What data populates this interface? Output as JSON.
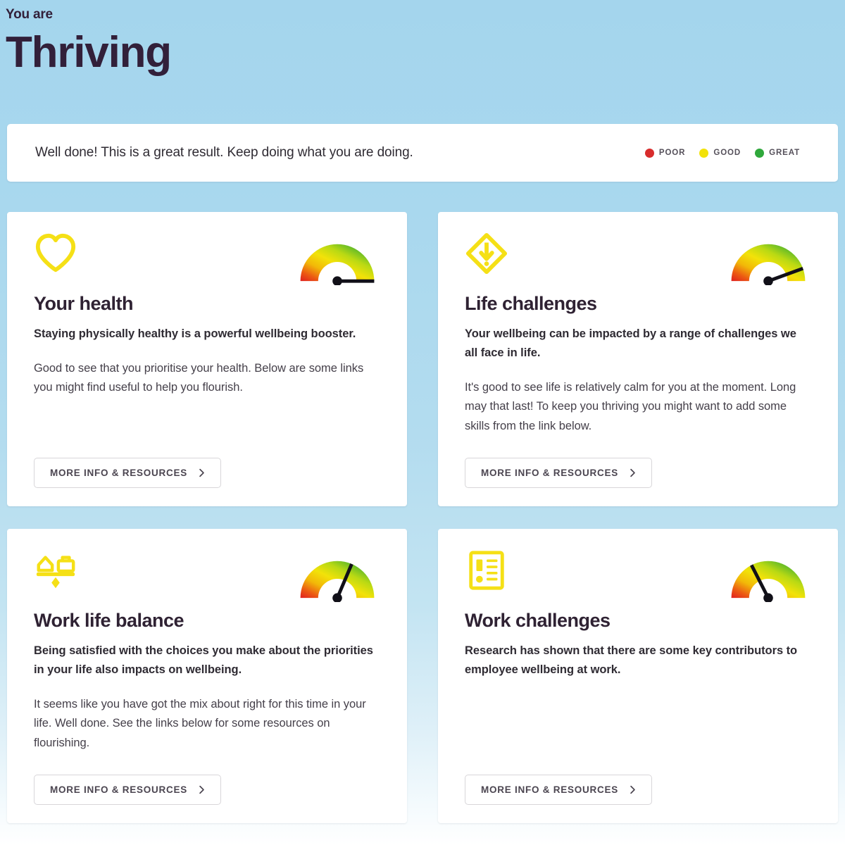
{
  "header": {
    "eyebrow": "You are",
    "title": "Thriving"
  },
  "banner": {
    "message": "Well done! This is a great result. Keep doing what you are doing.",
    "legend": [
      {
        "label": "POOR",
        "color": "#d82c2c",
        "icon": "legend-dot-poor"
      },
      {
        "label": "GOOD",
        "color": "#f2e209",
        "icon": "legend-dot-good"
      },
      {
        "label": "GREAT",
        "color": "#2fa83b",
        "icon": "legend-dot-great"
      }
    ]
  },
  "cards": [
    {
      "icon": "heart-icon",
      "title": "Your health",
      "lead": "Staying physically healthy is a powerful wellbeing booster.",
      "body": "Good to see that you prioritise your health. Below are some links you might find useful to help you flourish.",
      "cta": "MORE INFO & RESOURCES",
      "gauge_angle_deg": 0,
      "gauge_rating": "GREAT"
    },
    {
      "icon": "warning-diamond-icon",
      "title": "Life challenges",
      "lead": "Your wellbeing can be impacted by a range of challenges we all face in life.",
      "body": "It's good to see life is relatively calm for you at the moment. Long may that last! To keep you thriving you might want to add some skills from the link below.",
      "cta": "MORE INFO & RESOURCES",
      "gauge_angle_deg": 20,
      "gauge_rating": "GREAT"
    },
    {
      "icon": "work-life-balance-icon",
      "title": "Work life balance",
      "lead": "Being satisfied with the choices you make about the priorities in your life also impacts on wellbeing.",
      "body": "It seems like you have got the mix about right for this time in your life. Well done. See the links below for some resources on flourishing.",
      "cta": "MORE INFO & RESOURCES",
      "gauge_angle_deg": 67,
      "gauge_rating": "GOOD"
    },
    {
      "icon": "document-list-icon",
      "title": "Work challenges",
      "lead": "Research has shown that there are some key contributors to employee wellbeing at work.",
      "body": "",
      "cta": "MORE INFO & RESOURCES",
      "gauge_angle_deg": 117,
      "gauge_rating": "GOOD"
    }
  ],
  "theme": {
    "background_top": "#a4d5ed",
    "background_bottom": "#ffffff",
    "icon_yellow": "#f5e016",
    "text_dark": "#32203a",
    "gauge_red": "#e02020",
    "gauge_yellow": "#f2e209",
    "gauge_green": "#2fa83b"
  }
}
